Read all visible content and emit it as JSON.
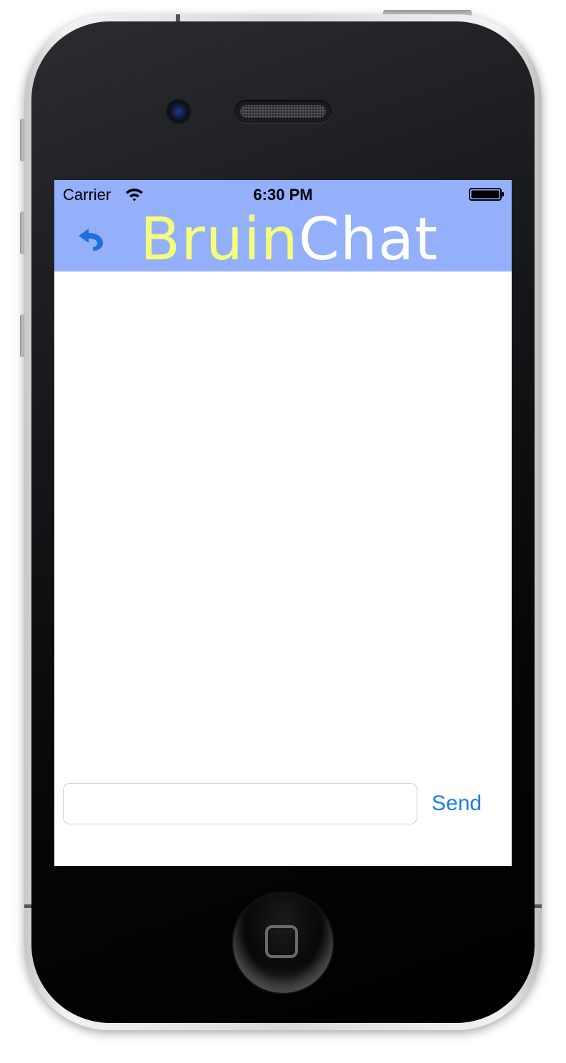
{
  "status_bar": {
    "carrier": "Carrier",
    "time": "6:30 PM",
    "wifi_icon": "wifi-icon",
    "battery_icon": "battery-full-icon"
  },
  "nav_bar": {
    "back_icon": "undo-arrow-icon",
    "title_part1": "Bruin",
    "title_part2": "Chat",
    "background_color": "#94b0fb",
    "title_part1_color": "#f5ff7a",
    "title_part2_color": "#ffffff"
  },
  "composer": {
    "input_value": "",
    "input_placeholder": "",
    "send_label": "Send",
    "send_color": "#1a7ee6"
  },
  "device": {
    "home_button_icon": "home-square-icon"
  }
}
